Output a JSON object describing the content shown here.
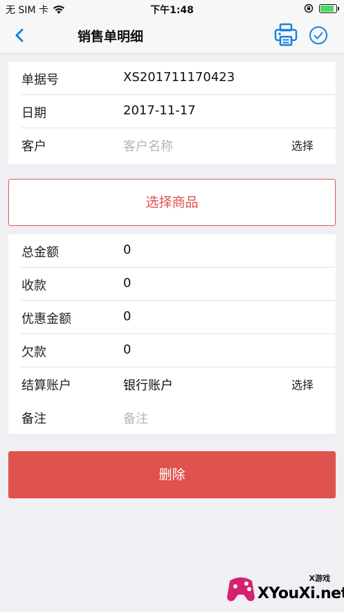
{
  "status_bar": {
    "carrier": "无 SIM 卡",
    "time": "下午1:48",
    "battery_level": 0.85
  },
  "nav": {
    "title": "销售单明细",
    "icons": [
      "back-chevron-icon",
      "printer-icon",
      "check-circle-icon"
    ]
  },
  "colors": {
    "accent_blue": "#1a7fe0",
    "accent_red": "#e0524d",
    "background": "#efeff4"
  },
  "header_rows": [
    {
      "label": "单据号",
      "value": "XS201711170423"
    },
    {
      "label": "日期",
      "value": "2017-11-17"
    },
    {
      "label": "客户",
      "placeholder": "客户名称",
      "action": "选择"
    }
  ],
  "select_goods_label": "选择商品",
  "amount_rows": [
    {
      "label": "总金额",
      "value": "0"
    },
    {
      "label": "收款",
      "value": "0"
    },
    {
      "label": "优惠金额",
      "value": "0"
    },
    {
      "label": "欠款",
      "value": "0"
    },
    {
      "label": "结算账户",
      "value": "银行账户",
      "action": "选择"
    },
    {
      "label": "备注",
      "placeholder": "备注"
    }
  ],
  "delete_label": "删除",
  "watermark": {
    "tag": "X游戏",
    "text": "XYouXi.net"
  }
}
